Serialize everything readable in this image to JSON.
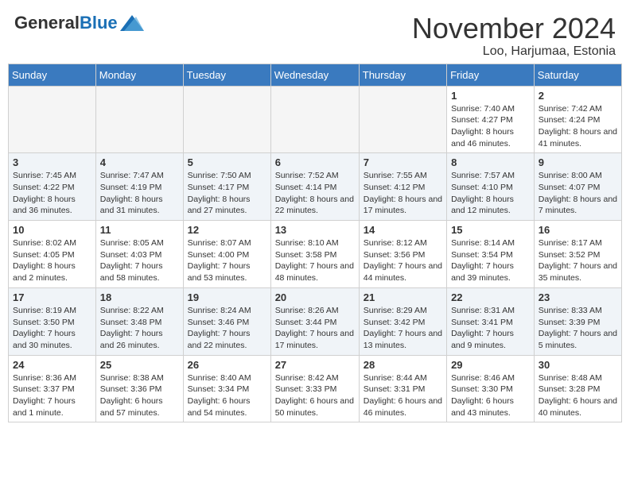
{
  "header": {
    "logo_general": "General",
    "logo_blue": "Blue",
    "month_title": "November 2024",
    "location": "Loo, Harjumaa, Estonia"
  },
  "days_of_week": [
    "Sunday",
    "Monday",
    "Tuesday",
    "Wednesday",
    "Thursday",
    "Friday",
    "Saturday"
  ],
  "weeks": [
    [
      {
        "day": "",
        "info": ""
      },
      {
        "day": "",
        "info": ""
      },
      {
        "day": "",
        "info": ""
      },
      {
        "day": "",
        "info": ""
      },
      {
        "day": "",
        "info": ""
      },
      {
        "day": "1",
        "info": "Sunrise: 7:40 AM\nSunset: 4:27 PM\nDaylight: 8 hours and 46 minutes."
      },
      {
        "day": "2",
        "info": "Sunrise: 7:42 AM\nSunset: 4:24 PM\nDaylight: 8 hours and 41 minutes."
      }
    ],
    [
      {
        "day": "3",
        "info": "Sunrise: 7:45 AM\nSunset: 4:22 PM\nDaylight: 8 hours and 36 minutes."
      },
      {
        "day": "4",
        "info": "Sunrise: 7:47 AM\nSunset: 4:19 PM\nDaylight: 8 hours and 31 minutes."
      },
      {
        "day": "5",
        "info": "Sunrise: 7:50 AM\nSunset: 4:17 PM\nDaylight: 8 hours and 27 minutes."
      },
      {
        "day": "6",
        "info": "Sunrise: 7:52 AM\nSunset: 4:14 PM\nDaylight: 8 hours and 22 minutes."
      },
      {
        "day": "7",
        "info": "Sunrise: 7:55 AM\nSunset: 4:12 PM\nDaylight: 8 hours and 17 minutes."
      },
      {
        "day": "8",
        "info": "Sunrise: 7:57 AM\nSunset: 4:10 PM\nDaylight: 8 hours and 12 minutes."
      },
      {
        "day": "9",
        "info": "Sunrise: 8:00 AM\nSunset: 4:07 PM\nDaylight: 8 hours and 7 minutes."
      }
    ],
    [
      {
        "day": "10",
        "info": "Sunrise: 8:02 AM\nSunset: 4:05 PM\nDaylight: 8 hours and 2 minutes."
      },
      {
        "day": "11",
        "info": "Sunrise: 8:05 AM\nSunset: 4:03 PM\nDaylight: 7 hours and 58 minutes."
      },
      {
        "day": "12",
        "info": "Sunrise: 8:07 AM\nSunset: 4:00 PM\nDaylight: 7 hours and 53 minutes."
      },
      {
        "day": "13",
        "info": "Sunrise: 8:10 AM\nSunset: 3:58 PM\nDaylight: 7 hours and 48 minutes."
      },
      {
        "day": "14",
        "info": "Sunrise: 8:12 AM\nSunset: 3:56 PM\nDaylight: 7 hours and 44 minutes."
      },
      {
        "day": "15",
        "info": "Sunrise: 8:14 AM\nSunset: 3:54 PM\nDaylight: 7 hours and 39 minutes."
      },
      {
        "day": "16",
        "info": "Sunrise: 8:17 AM\nSunset: 3:52 PM\nDaylight: 7 hours and 35 minutes."
      }
    ],
    [
      {
        "day": "17",
        "info": "Sunrise: 8:19 AM\nSunset: 3:50 PM\nDaylight: 7 hours and 30 minutes."
      },
      {
        "day": "18",
        "info": "Sunrise: 8:22 AM\nSunset: 3:48 PM\nDaylight: 7 hours and 26 minutes."
      },
      {
        "day": "19",
        "info": "Sunrise: 8:24 AM\nSunset: 3:46 PM\nDaylight: 7 hours and 22 minutes."
      },
      {
        "day": "20",
        "info": "Sunrise: 8:26 AM\nSunset: 3:44 PM\nDaylight: 7 hours and 17 minutes."
      },
      {
        "day": "21",
        "info": "Sunrise: 8:29 AM\nSunset: 3:42 PM\nDaylight: 7 hours and 13 minutes."
      },
      {
        "day": "22",
        "info": "Sunrise: 8:31 AM\nSunset: 3:41 PM\nDaylight: 7 hours and 9 minutes."
      },
      {
        "day": "23",
        "info": "Sunrise: 8:33 AM\nSunset: 3:39 PM\nDaylight: 7 hours and 5 minutes."
      }
    ],
    [
      {
        "day": "24",
        "info": "Sunrise: 8:36 AM\nSunset: 3:37 PM\nDaylight: 7 hours and 1 minute."
      },
      {
        "day": "25",
        "info": "Sunrise: 8:38 AM\nSunset: 3:36 PM\nDaylight: 6 hours and 57 minutes."
      },
      {
        "day": "26",
        "info": "Sunrise: 8:40 AM\nSunset: 3:34 PM\nDaylight: 6 hours and 54 minutes."
      },
      {
        "day": "27",
        "info": "Sunrise: 8:42 AM\nSunset: 3:33 PM\nDaylight: 6 hours and 50 minutes."
      },
      {
        "day": "28",
        "info": "Sunrise: 8:44 AM\nSunset: 3:31 PM\nDaylight: 6 hours and 46 minutes."
      },
      {
        "day": "29",
        "info": "Sunrise: 8:46 AM\nSunset: 3:30 PM\nDaylight: 6 hours and 43 minutes."
      },
      {
        "day": "30",
        "info": "Sunrise: 8:48 AM\nSunset: 3:28 PM\nDaylight: 6 hours and 40 minutes."
      }
    ]
  ]
}
